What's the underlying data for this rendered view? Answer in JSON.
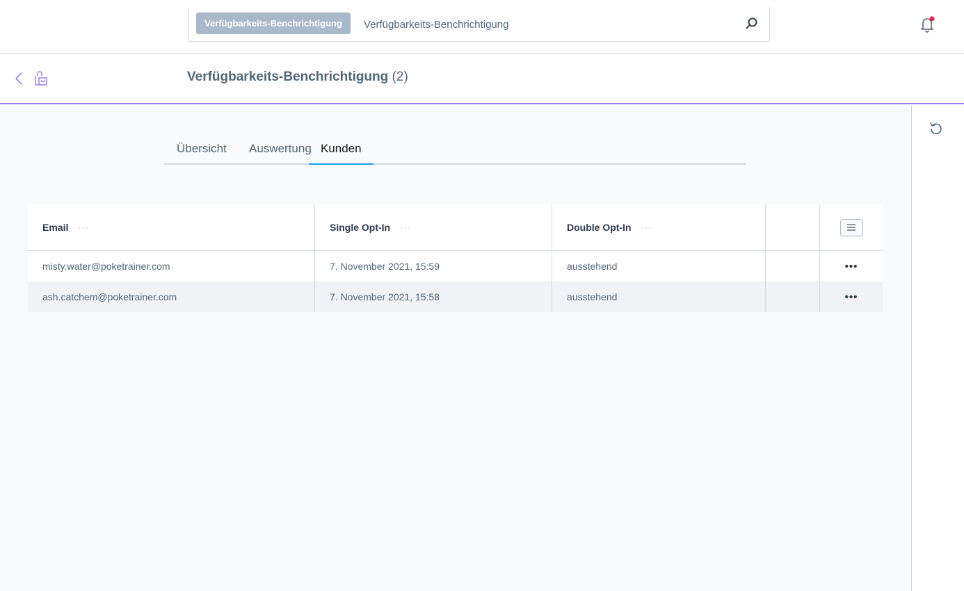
{
  "search": {
    "chip_label": "Verfügbarkeits-Benchrichtigung",
    "value": "Verfügbarkeits-Benchrichtigung"
  },
  "header": {
    "title": "Verfügbarkeits-Benchrichtigung",
    "count": "(2)"
  },
  "tabs": [
    {
      "label": "Übersicht",
      "active": false
    },
    {
      "label": "Auswertung",
      "active": false
    },
    {
      "label": "Kunden",
      "active": true
    }
  ],
  "grid": {
    "columns": [
      "Email",
      "Single Opt-In",
      "Double Opt-In"
    ],
    "column_menu_glyph": "···",
    "row_action_glyph": "•••",
    "rows": [
      {
        "email": "misty.water@poketrainer.com",
        "single_opt_in": "7. November 2021, 15:59",
        "double_opt_in": "ausstehend"
      },
      {
        "email": "ash.catchem@poketrainer.com",
        "single_opt_in": "7. November 2021, 15:58",
        "double_opt_in": "ausstehend"
      }
    ]
  },
  "colors": {
    "accent": "#9a7ff5",
    "tab_active": "#189eff",
    "notification_dot": "#de294c",
    "chip_bg": "#a8b9cc"
  },
  "icons": {
    "search": "search-icon",
    "bell": "bell-icon",
    "back": "chevron-left-icon",
    "module": "bag-icon",
    "refresh": "refresh-icon",
    "grid_settings": "list-icon"
  }
}
